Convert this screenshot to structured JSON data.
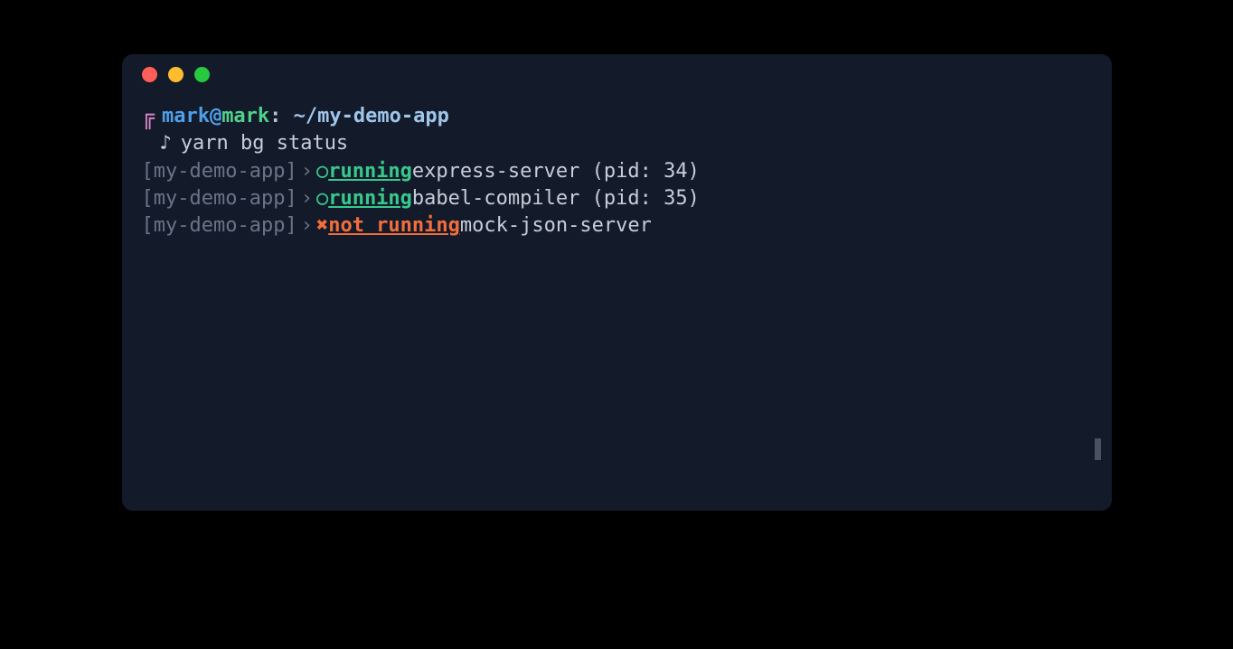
{
  "prompt": {
    "user": "mark",
    "at": "@",
    "host": "mark",
    "colon": ":",
    "path": "~/my-demo-app",
    "bracket_symbol": "⸢"
  },
  "command": {
    "music_note": "♪",
    "text": "yarn bg status"
  },
  "status_lines": [
    {
      "prefix_open": "[",
      "prefix_name": "my-demo-app",
      "prefix_close": "]",
      "chevron": "›",
      "icon": "○",
      "status": "running",
      "running": true,
      "padding_after_status": "      ",
      "process": "express-server",
      "pid_label": " (pid: ",
      "pid": "34",
      "pid_close": ")"
    },
    {
      "prefix_open": "[",
      "prefix_name": "my-demo-app",
      "prefix_close": "]",
      "chevron": "›",
      "icon": "○",
      "status": "running",
      "running": true,
      "padding_after_status": "      ",
      "process": "babel-compiler",
      "pid_label": " (pid: ",
      "pid": "35",
      "pid_close": ")"
    },
    {
      "prefix_open": "[",
      "prefix_name": "my-demo-app",
      "prefix_close": "]",
      "chevron": "›",
      "icon": "✖",
      "status": "not running",
      "running": false,
      "padding_after_status": "  ",
      "process": "mock-json-server",
      "pid_label": "",
      "pid": "",
      "pid_close": ""
    }
  ]
}
